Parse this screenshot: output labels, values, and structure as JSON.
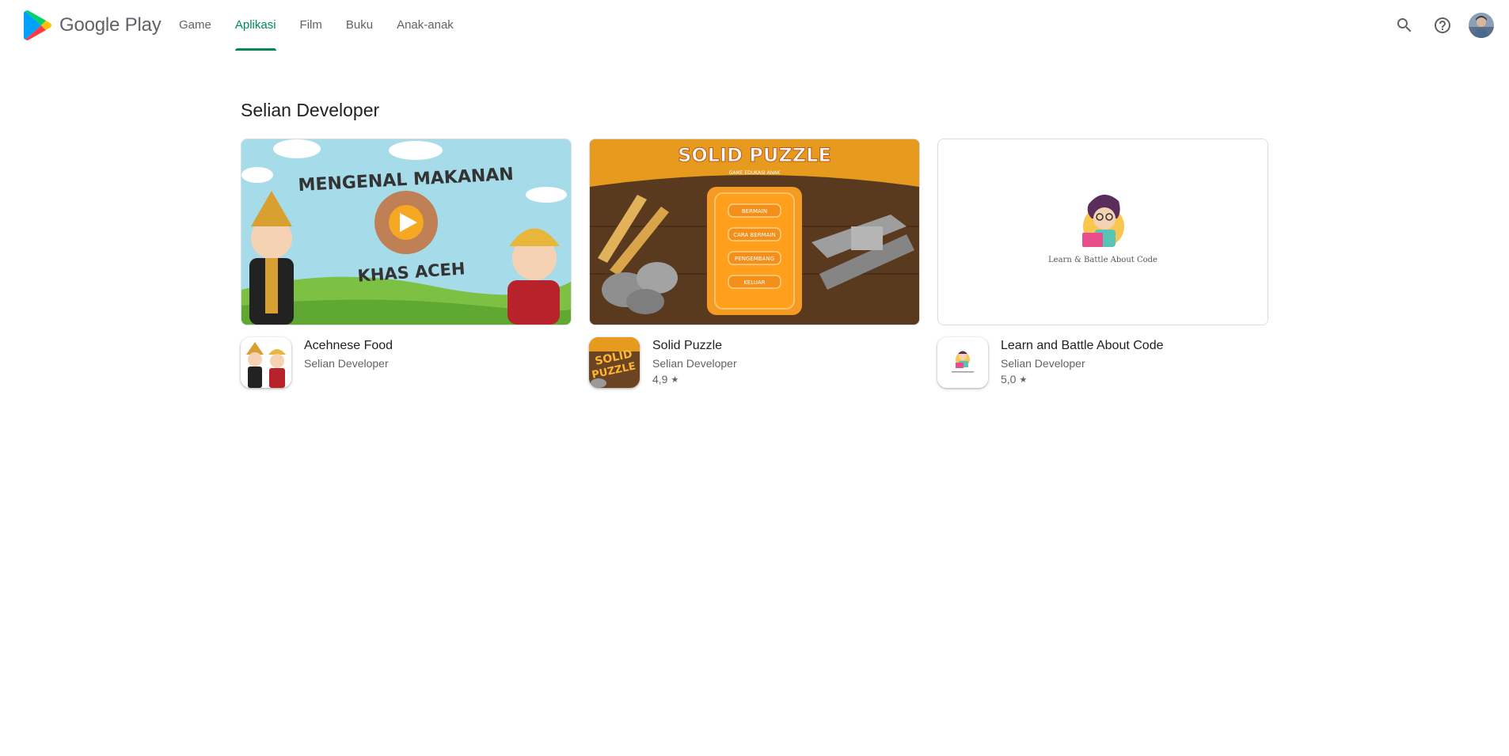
{
  "header": {
    "logo_text": "Google Play",
    "nav": [
      {
        "label": "Game",
        "active": false
      },
      {
        "label": "Aplikasi",
        "active": true
      },
      {
        "label": "Film",
        "active": false
      },
      {
        "label": "Buku",
        "active": false
      },
      {
        "label": "Anak-anak",
        "active": false
      }
    ],
    "icons": [
      "search-icon",
      "help-icon",
      "avatar"
    ]
  },
  "section": {
    "title": "Selian Developer"
  },
  "apps": [
    {
      "name": "Acehnese Food",
      "developer": "Selian Developer",
      "rating": "",
      "banner_text": [
        "MENGENAL MAKANAN",
        "KHAS ACEH"
      ]
    },
    {
      "name": "Solid Puzzle",
      "developer": "Selian Developer",
      "rating": "4,9",
      "banner_text": [
        "SOLID PUZZLE",
        "GAME EDUKASI ANAK",
        "BERMAIN",
        "CARA BERMAIN",
        "PENGEMBANG",
        "KELUAR"
      ],
      "icon_text": [
        "SOLID",
        "PUZZLE"
      ]
    },
    {
      "name": "Learn and Battle About Code",
      "developer": "Selian Developer",
      "rating": "5,0",
      "banner_text": [
        "Learn & Battle About Code"
      ]
    }
  ],
  "colors": {
    "accent": "#01875f",
    "text_primary": "#202124",
    "text_secondary": "#5f6368"
  }
}
